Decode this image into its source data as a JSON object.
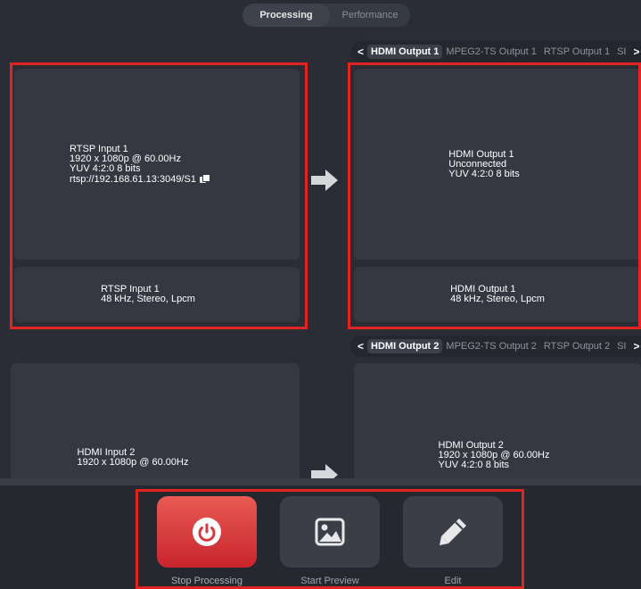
{
  "top_tabs": {
    "processing": "Processing",
    "performance": "Performance"
  },
  "output_tabs_1": {
    "prev": "<",
    "next": ">",
    "tabs": [
      "HDMI Output 1",
      "MPEG2-TS Output 1",
      "RTSP Output 1",
      "SI"
    ]
  },
  "output_tabs_2": {
    "prev": "<",
    "next": ">",
    "tabs": [
      "HDMI Output 2",
      "MPEG2-TS Output 2",
      "RTSP Output 2",
      "SI"
    ]
  },
  "input1": {
    "video": {
      "name": "RTSP Input 1",
      "resolution": "1920 x 1080p @ 60.00Hz",
      "format": "YUV 4:2:0 8 bits",
      "url": "rtsp://192.168.61.13:3049/S1"
    },
    "audio": {
      "name": "RTSP Input 1",
      "info": "48 kHz, Stereo, Lpcm"
    }
  },
  "output1": {
    "video": {
      "name": "HDMI Output 1",
      "status": "Unconnected",
      "format": "YUV 4:2:0 8 bits"
    },
    "audio": {
      "name": "HDMI Output 1",
      "info": "48 kHz, Stereo, Lpcm"
    }
  },
  "input2": {
    "video": {
      "name": "HDMI Input 2",
      "resolution": "1920 x 1080p @ 60.00Hz"
    }
  },
  "output2": {
    "video": {
      "name": "HDMI Output 2",
      "resolution": "1920 x 1080p @ 60.00Hz",
      "format": "YUV 4:2:0 8 bits"
    }
  },
  "toolbar": {
    "stop_label": "Stop Processing",
    "preview_label": "Start Preview",
    "edit_label": "Edit"
  },
  "icons": {
    "stop": "power-icon",
    "preview": "image-icon",
    "edit": "pencil-icon",
    "flow": "arrow-right-icon",
    "copy": "copy-icon"
  },
  "colors": {
    "highlight": "#e32222",
    "stop_button": "#d9363a",
    "panel": "#353841",
    "background": "#2a2d35"
  }
}
